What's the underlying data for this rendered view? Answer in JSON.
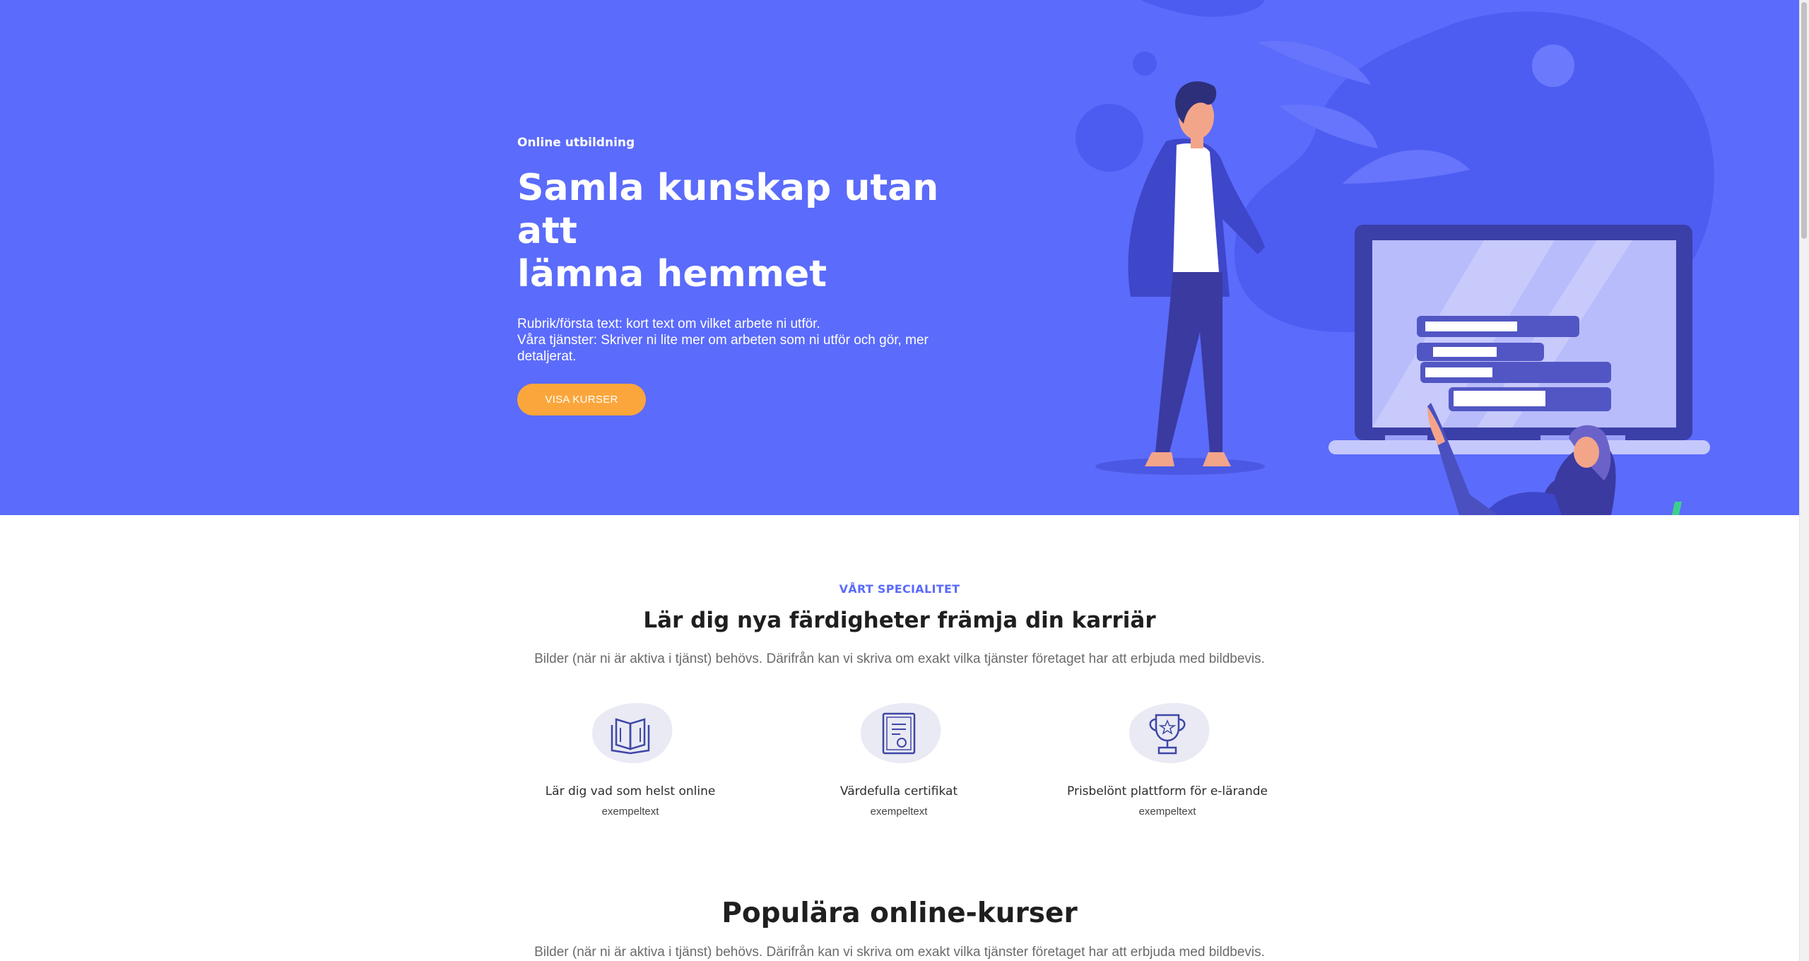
{
  "hero": {
    "eyebrow": "Online utbildning",
    "title_line1": "Samla kunskap utan att",
    "title_line2": "lämna hemmet",
    "desc_line1": "Rubrik/första text: kort text om vilket arbete ni utför.",
    "desc_line2": "Våra tjänster: Skriver ni lite mer om arbeten som ni utför och gör, mer",
    "desc_line3": "detaljerat.",
    "button_label": "VISA KURSER"
  },
  "specialty": {
    "eyebrow": "VÅRT SPECIALITET",
    "title": "Lär dig nya färdigheter främja din karriär",
    "subtitle": "Bilder (när ni är aktiva i tjänst) behövs. Därifrån kan vi skriva om exakt vilka tjänster företaget har att erbjuda med bildbevis.",
    "features": [
      {
        "icon": "book-icon",
        "title": "Lär dig vad som helst online",
        "desc": "exempeltext"
      },
      {
        "icon": "certificate-icon",
        "title": "Värdefulla certifikat",
        "desc": "exempeltext"
      },
      {
        "icon": "trophy-icon",
        "title": "Prisbelönt plattform för e-lärande",
        "desc": "exempeltext"
      }
    ]
  },
  "popular": {
    "title": "Populära online-kurser",
    "subtitle": "Bilder (när ni är aktiva i tjänst) behövs. Därifrån kan vi skriva om exakt vilka tjänster företaget har att erbjuda med bildbevis."
  },
  "colors": {
    "hero_bg": "#5b6bfb",
    "accent": "#fba63c",
    "eyebrow": "#5b6bfb"
  }
}
